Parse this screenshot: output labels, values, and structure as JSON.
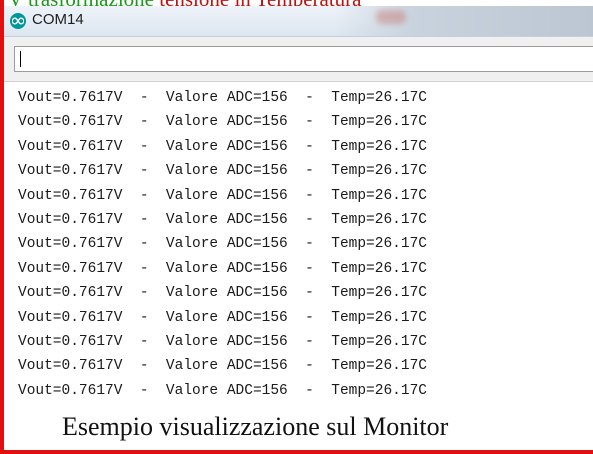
{
  "header_caption": {
    "part1": "V trasformazione ",
    "part2": "tensione in Temperatura"
  },
  "window": {
    "title": "COM14",
    "app_icon": "arduino-infinity-icon"
  },
  "send_field": {
    "value": "|"
  },
  "serial_output": {
    "lines": [
      "Vout=0.7617V  -  Valore ADC=156  -  Temp=26.17C",
      "Vout=0.7617V  -  Valore ADC=156  -  Temp=26.17C",
      "Vout=0.7617V  -  Valore ADC=156  -  Temp=26.17C",
      "Vout=0.7617V  -  Valore ADC=156  -  Temp=26.17C",
      "Vout=0.7617V  -  Valore ADC=156  -  Temp=26.17C",
      "Vout=0.7617V  -  Valore ADC=156  -  Temp=26.17C",
      "Vout=0.7617V  -  Valore ADC=156  -  Temp=26.17C",
      "Vout=0.7617V  -  Valore ADC=156  -  Temp=26.17C",
      "Vout=0.7617V  -  Valore ADC=156  -  Temp=26.17C",
      "Vout=0.7617V  -  Valore ADC=156  -  Temp=26.17C",
      "Vout=0.7617V  -  Valore ADC=156  -  Temp=26.17C",
      "Vout=0.7617V  -  Valore ADC=156  -  Temp=26.17C",
      "Vout=0.7617V  -  Valore ADC=156  -  Temp=26.17C"
    ]
  },
  "footer_caption": "Esempio visualizzazione sul Monitor",
  "colors": {
    "frame_red": "#e01010",
    "arduino_teal": "#00979c",
    "caption_green": "#1a9a1a"
  }
}
